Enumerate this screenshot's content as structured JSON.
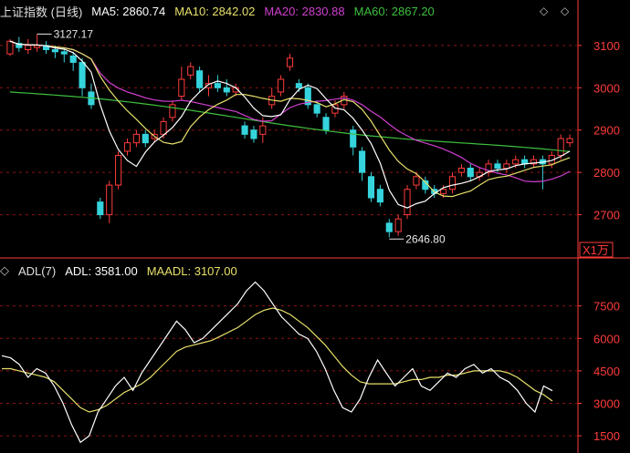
{
  "colors": {
    "up": "#ff3b3b",
    "down": "#35d4dd",
    "ma5": "#ffffff",
    "ma10": "#e7e06b",
    "ma20": "#d03fd0",
    "ma60": "#3ebf3e",
    "grid": "#8b1414",
    "axis": "#ff3b3b"
  },
  "header": {
    "title": "上证指数 (日线)",
    "ma5": "MA5: 2860.74",
    "ma10": "MA10: 2842.02",
    "ma20": "MA20: 2830.88",
    "ma60": "MA60: 2867.20",
    "icon_left": "diamond-icon",
    "icon_right": "diamond-icon"
  },
  "price_panel": {
    "y_ticks": [
      "3100",
      "3000",
      "2900",
      "2800",
      "2700"
    ],
    "unit_label": "X1万",
    "high_label": "3127.17",
    "low_label": "2646.80"
  },
  "adl_panel": {
    "title": "ADL(7)",
    "adl": "ADL: 3581.00",
    "maadl": "MAADL: 3107.00",
    "y_ticks": [
      "7500",
      "6000",
      "4500",
      "3000",
      "1500"
    ]
  },
  "chart_data": {
    "type": "candlestick",
    "price": {
      "ylim": [
        2600,
        3160
      ],
      "candles": [
        [
          3080,
          3110,
          3075,
          3115
        ],
        [
          3105,
          3095,
          3085,
          3120
        ],
        [
          3090,
          3100,
          3080,
          3115
        ],
        [
          3095,
          3100,
          3085,
          3127
        ],
        [
          3100,
          3090,
          3080,
          3110
        ],
        [
          3090,
          3085,
          3070,
          3100
        ],
        [
          3085,
          3080,
          3060,
          3095
        ],
        [
          3075,
          3060,
          3040,
          3085
        ],
        [
          3060,
          3000,
          2980,
          3070
        ],
        [
          2990,
          2960,
          2950,
          3010
        ],
        [
          2730,
          2700,
          2690,
          2740
        ],
        [
          2700,
          2770,
          2680,
          2780
        ],
        [
          2770,
          2840,
          2760,
          2850
        ],
        [
          2850,
          2870,
          2840,
          2880
        ],
        [
          2870,
          2890,
          2860,
          2900
        ],
        [
          2890,
          2870,
          2860,
          2900
        ],
        [
          2880,
          2890,
          2870,
          2900
        ],
        [
          2890,
          2920,
          2880,
          2930
        ],
        [
          2930,
          2960,
          2920,
          2970
        ],
        [
          2980,
          3020,
          2970,
          3050
        ],
        [
          3030,
          3050,
          3020,
          3060
        ],
        [
          3040,
          3000,
          2990,
          3050
        ],
        [
          3000,
          3010,
          2980,
          3030
        ],
        [
          3010,
          3000,
          2990,
          3030
        ],
        [
          3000,
          2990,
          2980,
          3020
        ],
        [
          2990,
          3000,
          2980,
          3010
        ],
        [
          2910,
          2890,
          2880,
          2920
        ],
        [
          2900,
          2880,
          2870,
          2910
        ],
        [
          2890,
          2910,
          2870,
          2930
        ],
        [
          2960,
          2980,
          2950,
          3000
        ],
        [
          2990,
          3020,
          2980,
          3030
        ],
        [
          3050,
          3070,
          3040,
          3080
        ],
        [
          3010,
          3000,
          2990,
          3020
        ],
        [
          3000,
          2960,
          2950,
          3010
        ],
        [
          2960,
          2940,
          2930,
          2970
        ],
        [
          2930,
          2900,
          2890,
          2940
        ],
        [
          2940,
          2960,
          2930,
          2970
        ],
        [
          2960,
          2980,
          2950,
          2990
        ],
        [
          2900,
          2860,
          2840,
          2910
        ],
        [
          2850,
          2800,
          2780,
          2860
        ],
        [
          2790,
          2740,
          2730,
          2800
        ],
        [
          2760,
          2730,
          2720,
          2770
        ],
        [
          2680,
          2660,
          2646.8,
          2690
        ],
        [
          2660,
          2690,
          2650,
          2700
        ],
        [
          2700,
          2760,
          2690,
          2770
        ],
        [
          2770,
          2790,
          2760,
          2800
        ],
        [
          2780,
          2760,
          2750,
          2790
        ],
        [
          2760,
          2750,
          2740,
          2770
        ],
        [
          2750,
          2760,
          2740,
          2770
        ],
        [
          2760,
          2790,
          2750,
          2800
        ],
        [
          2800,
          2810,
          2790,
          2820
        ],
        [
          2810,
          2790,
          2780,
          2820
        ],
        [
          2790,
          2800,
          2780,
          2810
        ],
        [
          2800,
          2820,
          2790,
          2830
        ],
        [
          2820,
          2810,
          2800,
          2830
        ],
        [
          2810,
          2820,
          2800,
          2830
        ],
        [
          2820,
          2830,
          2810,
          2840
        ],
        [
          2830,
          2820,
          2810,
          2840
        ],
        [
          2820,
          2830,
          2810,
          2840
        ],
        [
          2830,
          2820,
          2760,
          2840
        ],
        [
          2820,
          2840,
          2810,
          2850
        ],
        [
          2840,
          2880,
          2830,
          2890
        ],
        [
          2870,
          2880,
          2860,
          2890
        ]
      ]
    },
    "adl": {
      "ylim": [
        1000,
        9000
      ],
      "adl": [
        5200,
        5100,
        4800,
        4200,
        4600,
        4400,
        3800,
        3000,
        2000,
        1200,
        1500,
        2600,
        3200,
        3800,
        4200,
        3600,
        4400,
        5000,
        5600,
        6200,
        6800,
        6400,
        5800,
        6000,
        6400,
        6800,
        7200,
        7600,
        8200,
        8600,
        8200,
        7600,
        7000,
        6600,
        6200,
        6000,
        5400,
        4600,
        3600,
        2800,
        2600,
        3200,
        4200,
        5000,
        4400,
        3800,
        4200,
        4600,
        3800,
        3600,
        4000,
        4400,
        4200,
        4600,
        4800,
        4400,
        4600,
        4200,
        4000,
        3600,
        3000,
        2600,
        3800,
        3581
      ],
      "maadl": [
        4600,
        4600,
        4500,
        4400,
        4300,
        4200,
        4000,
        3600,
        3200,
        2800,
        2600,
        2700,
        2900,
        3200,
        3500,
        3700,
        3900,
        4200,
        4600,
        5000,
        5400,
        5600,
        5700,
        5800,
        5900,
        6100,
        6300,
        6500,
        6800,
        7100,
        7300,
        7400,
        7300,
        7100,
        6800,
        6500,
        6100,
        5700,
        5200,
        4700,
        4300,
        4000,
        3900,
        3900,
        3900,
        3900,
        4000,
        4100,
        4100,
        4200,
        4200,
        4300,
        4300,
        4400,
        4500,
        4500,
        4500,
        4500,
        4400,
        4200,
        3900,
        3600,
        3400,
        3107
      ]
    }
  }
}
